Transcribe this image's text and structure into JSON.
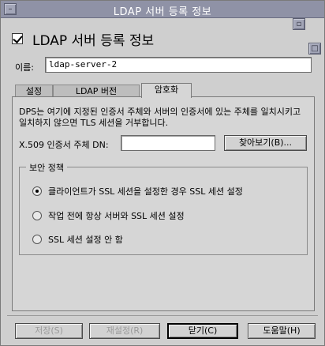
{
  "window": {
    "title": "LDAP 서버 등록 정보"
  },
  "heading": {
    "text": "LDAP 서버 등록 정보"
  },
  "name_field": {
    "label": "이름:",
    "value": "ldap-server-2"
  },
  "tabs": [
    {
      "label": "설정",
      "selected": false
    },
    {
      "label": "LDAP 버전",
      "selected": false
    },
    {
      "label": "암호화",
      "selected": true
    }
  ],
  "encryption": {
    "description": "DPS는 여기에 지정된 인증서 주체와 서버의 인증서에 있는 주체를 일치시키고 일치하지 않으면 TLS 세션을 거부합니다.",
    "dn_label": "X.509 인증서 주체 DN:",
    "dn_value": "",
    "browse_label": "찾아보기(B)...",
    "policy_legend": "보안 정책",
    "options": [
      {
        "label": "클라이언트가 SSL 세션을 설정한 경우 SSL 세션 설정",
        "selected": true
      },
      {
        "label": "작업 전에 항상 서버와 SSL 세션 설정",
        "selected": false
      },
      {
        "label": "SSL 세션 설정 안 함",
        "selected": false
      }
    ]
  },
  "buttons": {
    "save": "저장(S)",
    "reset": "재설정(R)",
    "close": "닫기(C)",
    "help": "도움말(H)"
  }
}
